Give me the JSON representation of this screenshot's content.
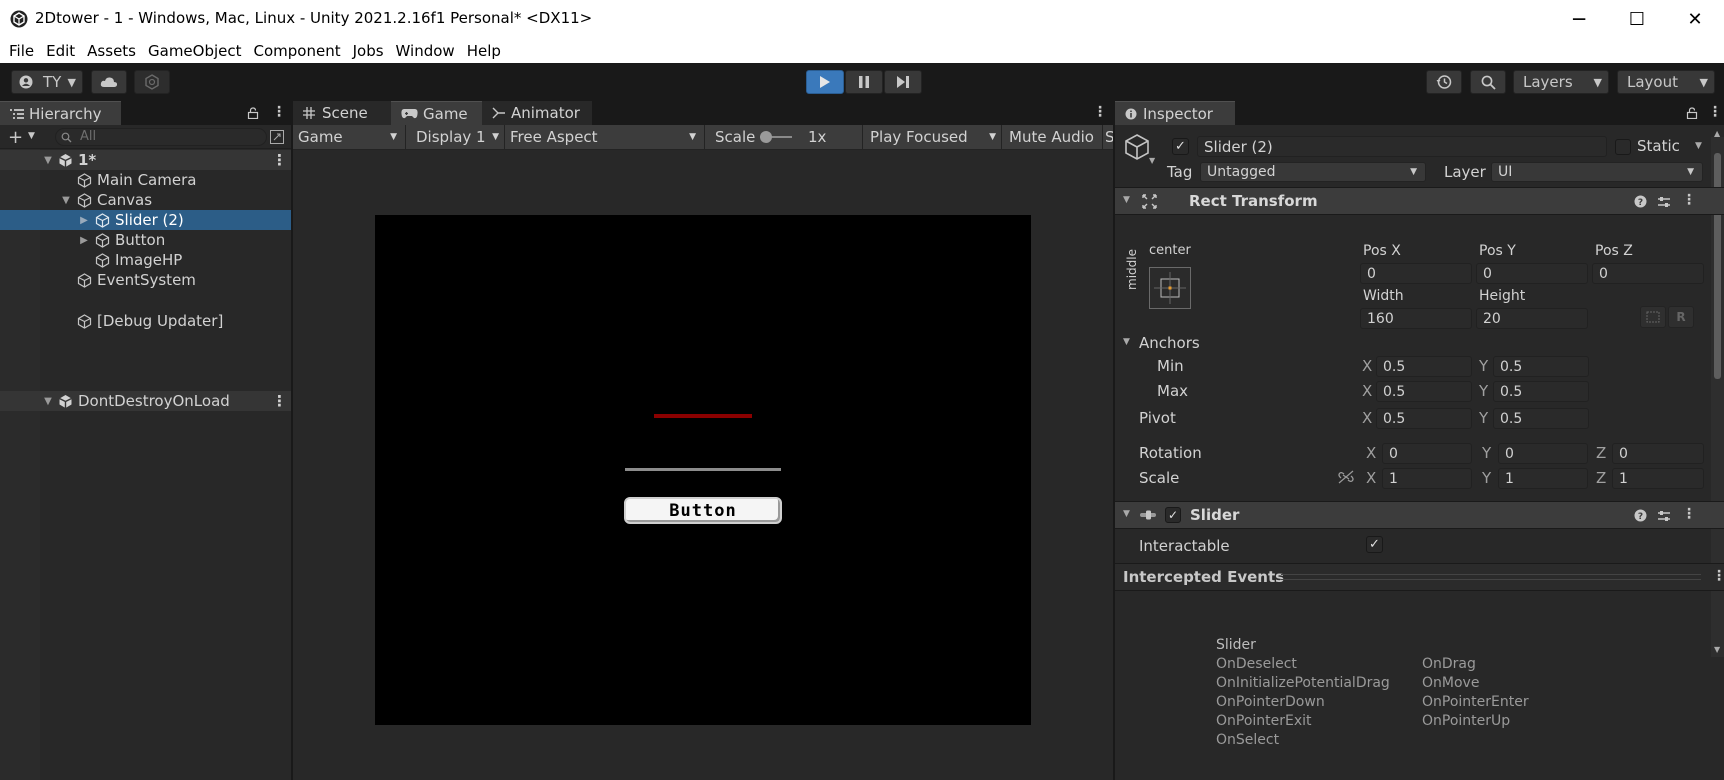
{
  "window": {
    "title": "2Dtower - 1 - Windows, Mac, Linux - Unity 2021.2.16f1 Personal* <DX11>",
    "minimize": "─",
    "maximize": "☐",
    "close": "✕"
  },
  "menu": [
    "File",
    "Edit",
    "Assets",
    "GameObject",
    "Component",
    "Jobs",
    "Window",
    "Help"
  ],
  "toolbar": {
    "account": "TY",
    "layers": "Layers",
    "layout": "Layout"
  },
  "hierarchy": {
    "tab": "Hierarchy",
    "search_placeholder": "All",
    "rows": [
      {
        "label": "1*",
        "depth": 0,
        "kind": "scene",
        "expanded": true
      },
      {
        "label": "Main Camera",
        "depth": 1,
        "kind": "object"
      },
      {
        "label": "Canvas",
        "depth": 1,
        "kind": "object",
        "expanded": true
      },
      {
        "label": "Slider (2)",
        "depth": 2,
        "kind": "object",
        "selected": true,
        "collapsed": true
      },
      {
        "label": "Button",
        "depth": 2,
        "kind": "object",
        "collapsed": true
      },
      {
        "label": "ImageHP",
        "depth": 2,
        "kind": "object"
      },
      {
        "label": "EventSystem",
        "depth": 1,
        "kind": "object"
      },
      {
        "label": "DontDestroyOnLoad",
        "depth": 0,
        "kind": "scene",
        "expanded": true
      },
      {
        "label": "[Debug Updater]",
        "depth": 1,
        "kind": "object"
      }
    ]
  },
  "game": {
    "tabs": [
      "Scene",
      "Game",
      "Animator"
    ],
    "display_mode": "Game",
    "display": "Display 1",
    "aspect": "Free Aspect",
    "scale_label": "Scale",
    "scale_value": "1x",
    "play_mode": "Play Focused",
    "mute": "Mute Audio",
    "trailing": "S",
    "button_text": "Button"
  },
  "inspector": {
    "tab": "Inspector",
    "object_name": "Slider (2)",
    "static_label": "Static",
    "tag_label": "Tag",
    "tag_value": "Untagged",
    "layer_label": "Layer",
    "layer_value": "UI",
    "rect_transform": {
      "title": "Rect Transform",
      "anchor_h": "center",
      "anchor_v": "middle",
      "pos_x_label": "Pos X",
      "pos_y_label": "Pos Y",
      "pos_z_label": "Pos Z",
      "pos_x": "0",
      "pos_y": "0",
      "pos_z": "0",
      "width_label": "Width",
      "height_label": "Height",
      "width": "160",
      "height": "20",
      "anchors_label": "Anchors",
      "min_label": "Min",
      "max_label": "Max",
      "min_x": "0.5",
      "min_y": "0.5",
      "max_x": "0.5",
      "max_y": "0.5",
      "pivot_label": "Pivot",
      "pivot_x": "0.5",
      "pivot_y": "0.5",
      "rotation_label": "Rotation",
      "rot_x": "0",
      "rot_y": "0",
      "rot_z": "0",
      "scale_label": "Scale",
      "scale_x": "1",
      "scale_y": "1",
      "scale_z": "1",
      "x": "X",
      "y": "Y",
      "z": "Z"
    },
    "slider": {
      "title": "Slider",
      "interactable_label": "Interactable"
    },
    "intercepted": {
      "title": "Intercepted Events",
      "group": "Slider",
      "left": [
        "OnDeselect",
        "OnInitializePotentialDrag",
        "OnPointerDown",
        "OnPointerExit",
        "OnSelect"
      ],
      "right": [
        "OnDrag",
        "OnMove",
        "OnPointerEnter",
        "OnPointerUp"
      ]
    }
  },
  "colors": {
    "selection": "#2c5d87",
    "play_active": "#3a79bb",
    "hp_bar": "#8b0000"
  }
}
